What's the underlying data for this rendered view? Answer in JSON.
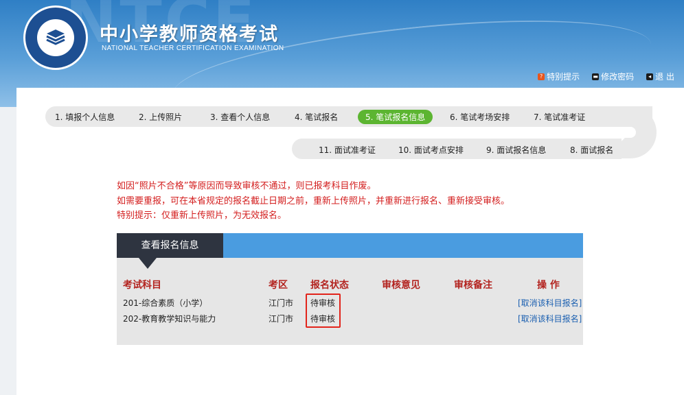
{
  "header": {
    "title": "中小学教师资格考试",
    "subtitle": "NATIONAL TEACHER CERTIFICATION EXAMINATION",
    "watermark": "NTCE",
    "links": [
      {
        "label": "特别提示",
        "icon": "info-icon"
      },
      {
        "label": "修改密码",
        "icon": "key-icon"
      },
      {
        "label": "退 出",
        "icon": "logout-icon"
      }
    ]
  },
  "steps": [
    {
      "label": "1. 填报个人信息"
    },
    {
      "label": "2. 上传照片"
    },
    {
      "label": "3. 查看个人信息"
    },
    {
      "label": "4. 笔试报名"
    },
    {
      "label": "5. 笔试报名信息",
      "active": true
    },
    {
      "label": "6. 笔试考场安排"
    },
    {
      "label": "7. 笔试准考证"
    },
    {
      "label": "8. 面试报名"
    },
    {
      "label": "9. 面试报名信息"
    },
    {
      "label": "10. 面试考点安排"
    },
    {
      "label": "11. 面试准考证"
    }
  ],
  "notice": [
    "如因“照片不合格”等原因而导致审核不通过，则已报考科目作废。",
    "如需要重报，可在本省规定的报名截止日期之前，重新上传照片，并重新进行报名、重新接受审核。",
    "特别提示：仅重新上传照片，为无效报名。"
  ],
  "table": {
    "tab": "查看报名信息",
    "headers": [
      "考试科目",
      "考区",
      "报名状态",
      "审核意见",
      "审核备注",
      "操 作"
    ],
    "rows": [
      {
        "subject": "201-综合素质（小学）",
        "area": "江门市",
        "status": "待审核",
        "opinion": "",
        "remark": "",
        "action": "[取消该科目报名]"
      },
      {
        "subject": "202-教育教学知识与能力",
        "area": "江门市",
        "status": "待审核",
        "opinion": "",
        "remark": "",
        "action": "[取消该科目报名]"
      }
    ]
  },
  "colors": {
    "accent_green": "#5cb531",
    "notice_red": "#d31d1d",
    "header_blue": "#2f7fc5",
    "table_bar_blue": "#4a9ce0",
    "highlight_red": "#e2231a"
  }
}
